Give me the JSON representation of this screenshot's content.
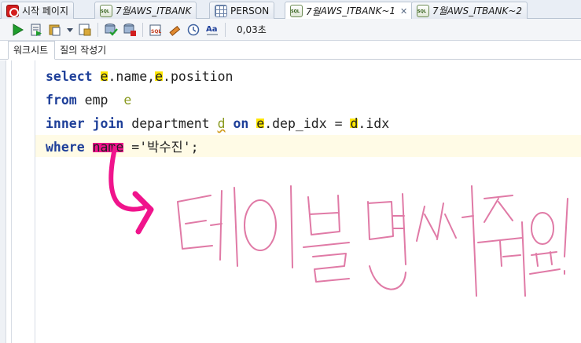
{
  "tabs": [
    {
      "label": "시작 페이지",
      "icon": "db-icon",
      "active": false
    },
    {
      "label_prefix": "7월",
      "label": " AWS_ITBANK",
      "icon": "sql-icon",
      "active": false
    },
    {
      "label": "PERSON",
      "icon": "table-icon",
      "active": false
    },
    {
      "label_prefix": "7월",
      "label": " AWS_ITBANK~1",
      "icon": "sql-icon",
      "active": true
    },
    {
      "label_prefix": "7월",
      "label": " AWS_ITBANK~2",
      "icon": "sql-icon",
      "active": false
    }
  ],
  "toolbar": {
    "elapsed": "0,03초",
    "buttons": [
      "run-statement-icon",
      "run-script-icon",
      "explain-plan-icon",
      "dropdown-icon",
      "autotrace-icon",
      "commit-icon",
      "rollback-icon",
      "sql-tuning-icon",
      "clear-icon",
      "history-icon",
      "format-icon"
    ]
  },
  "subtabs": [
    "워크시트",
    "질의 작성기"
  ],
  "editor": {
    "lines": [
      [
        {
          "t": "select ",
          "c": "kw"
        },
        {
          "t": "e",
          "c": "id hl"
        },
        {
          "t": ".name,",
          "c": "id"
        },
        {
          "t": "e",
          "c": "id hl"
        },
        {
          "t": ".position",
          "c": "id"
        }
      ],
      [
        {
          "t": "from ",
          "c": "kw"
        },
        {
          "t": "emp  ",
          "c": "id"
        },
        {
          "t": "e",
          "c": "alias"
        }
      ],
      [
        {
          "t": "inner join ",
          "c": "kw"
        },
        {
          "t": "department ",
          "c": "id"
        },
        {
          "t": "d",
          "c": "alias squig"
        },
        {
          "t": " ",
          "c": "id"
        },
        {
          "t": "on ",
          "c": "kw"
        },
        {
          "t": "e",
          "c": "id hl"
        },
        {
          "t": ".dep_idx = ",
          "c": "id"
        },
        {
          "t": "d",
          "c": "id hl"
        },
        {
          "t": ".idx",
          "c": "id"
        }
      ],
      [
        {
          "t": "where ",
          "c": "kw"
        },
        {
          "t": "name",
          "c": "id hlp"
        },
        {
          "t": " ='박수진';",
          "c": "id"
        }
      ]
    ]
  },
  "annotation": {
    "handwritten_text": "테이블 명써줘요!",
    "highlight_color": "#ffe600",
    "pen_color": "#f0148c",
    "handwriting_color": "#e07aa6"
  }
}
